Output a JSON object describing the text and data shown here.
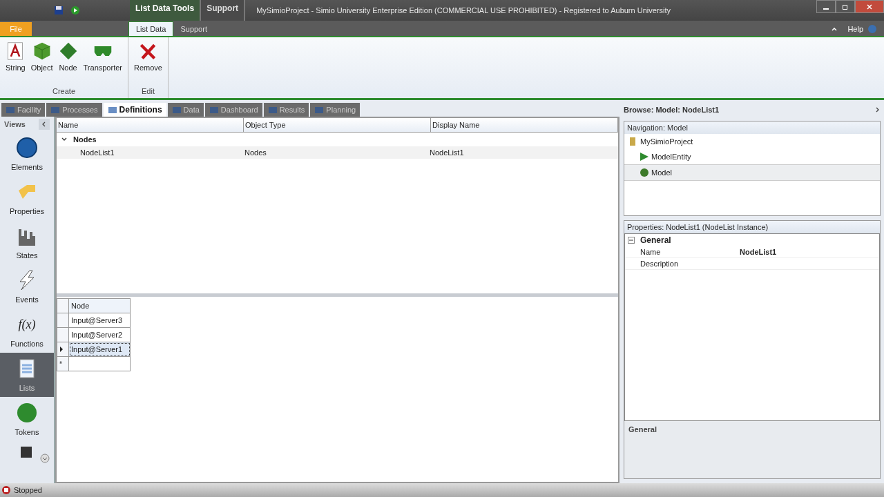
{
  "window": {
    "title": "MySimioProject - Simio University Enterprise Edition (COMMERCIAL USE PROHIBITED) - Registered to Auburn University",
    "context_tabs": [
      {
        "label": "List Data Tools",
        "selected": true
      },
      {
        "label": "Support",
        "selected": false
      }
    ]
  },
  "ribbon": {
    "tabs": [
      {
        "label": "File",
        "kind": "file",
        "selected": false
      },
      {
        "label": "List Data",
        "kind": "tab",
        "selected": true
      },
      {
        "label": "Support",
        "kind": "tab",
        "selected": false
      }
    ],
    "help": "Help",
    "groups": [
      {
        "label": "Create",
        "buttons": [
          {
            "label": "String"
          },
          {
            "label": "Object"
          },
          {
            "label": "Node"
          },
          {
            "label": "Transporter"
          }
        ]
      },
      {
        "label": "Edit",
        "buttons": [
          {
            "label": "Remove"
          }
        ]
      }
    ]
  },
  "view_tabs": [
    {
      "label": "Facility",
      "selected": false
    },
    {
      "label": "Processes",
      "selected": false
    },
    {
      "label": "Definitions",
      "selected": true
    },
    {
      "label": "Data",
      "selected": false
    },
    {
      "label": "Dashboard",
      "selected": false
    },
    {
      "label": "Results",
      "selected": false
    },
    {
      "label": "Planning",
      "selected": false
    }
  ],
  "views": {
    "title": "Views",
    "items": [
      {
        "label": "Elements",
        "selected": false
      },
      {
        "label": "Properties",
        "selected": false
      },
      {
        "label": "States",
        "selected": false
      },
      {
        "label": "Events",
        "selected": false
      },
      {
        "label": "Functions",
        "symbol": "f(x)",
        "selected": false
      },
      {
        "label": "Lists",
        "selected": true
      },
      {
        "label": "Tokens",
        "selected": false
      }
    ]
  },
  "lists_table": {
    "columns": [
      "Name",
      "Object Type",
      "Display Name"
    ],
    "groups": [
      {
        "label": "Nodes",
        "expanded": true,
        "rows": [
          {
            "name": "NodeList1",
            "type": "Nodes",
            "display": "NodeList1"
          }
        ]
      }
    ]
  },
  "node_grid": {
    "column": "Node",
    "rows": [
      {
        "value": "Input@Server3",
        "current": false
      },
      {
        "value": "Input@Server2",
        "current": false
      },
      {
        "value": "Input@Server1",
        "current": true
      }
    ],
    "new_row_mark": "*"
  },
  "browse": {
    "title": "Browse: Model: NodeList1",
    "navigation_title": "Navigation: Model",
    "tree": [
      {
        "label": "MySimioProject",
        "selected": false,
        "children": [
          {
            "label": "ModelEntity",
            "selected": false
          },
          {
            "label": "Model",
            "selected": true
          }
        ]
      }
    ]
  },
  "properties": {
    "title": "Properties: NodeList1 (NodeList Instance)",
    "category": "General",
    "expanded": true,
    "rows": [
      {
        "name": "Name",
        "value": "NodeList1"
      },
      {
        "name": "Description"
      }
    ],
    "help_title": "General"
  },
  "status_bar": {
    "state": "Stopped"
  }
}
